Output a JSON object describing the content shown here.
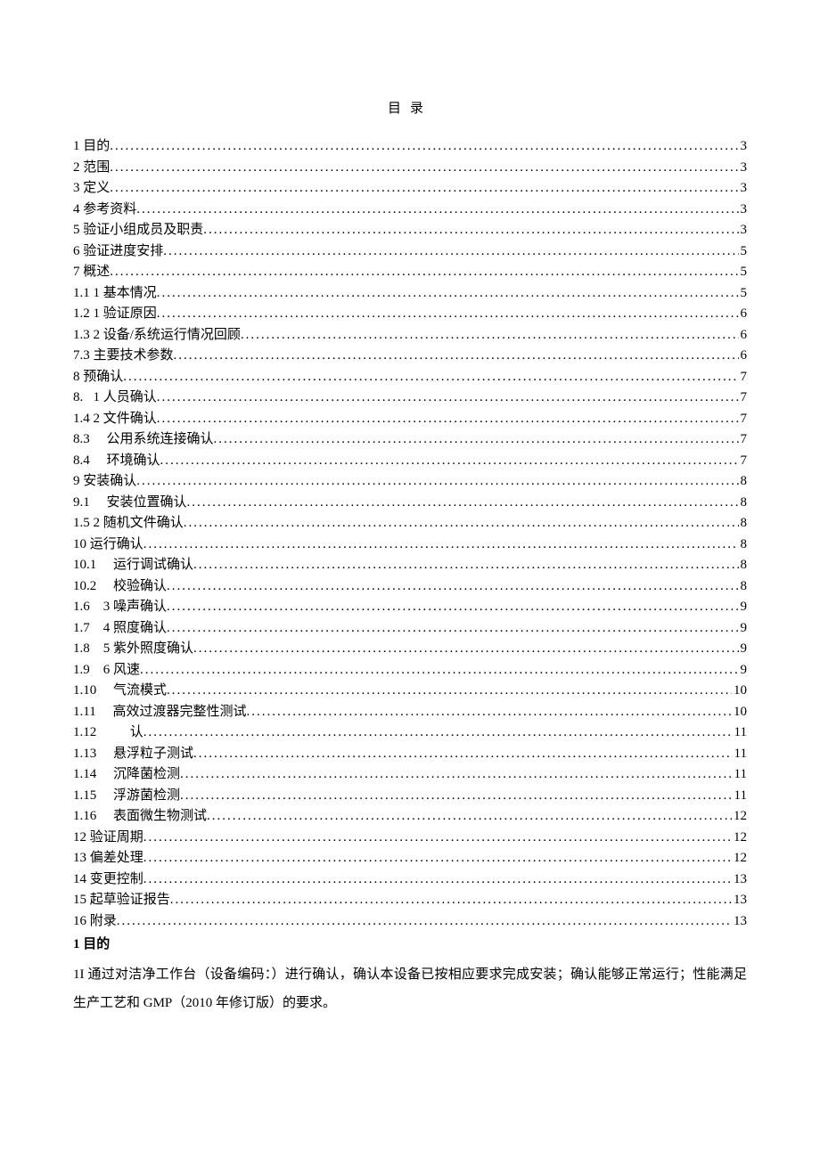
{
  "title": "目录",
  "toc": [
    {
      "label": "1 目的",
      "page": "3"
    },
    {
      "label": "2 范围",
      "page": "3"
    },
    {
      "label": "3 定义",
      "page": "3"
    },
    {
      "label": "4 参考资料",
      "page": "3"
    },
    {
      "label": "5 验证小组成员及职责",
      "page": "3"
    },
    {
      "label": "6 验证进度安排",
      "page": "5"
    },
    {
      "label": "7 概述",
      "page": "5"
    },
    {
      "label": "1.1  1 基本情况",
      "page": "5"
    },
    {
      "label": "1.2  1 验证原因",
      "page": "6"
    },
    {
      "label": "1.3  2 设备/系统运行情况回顾",
      "page": "6"
    },
    {
      "label": "7.3 主要技术参数",
      "page": "6"
    },
    {
      "label": "8 预确认",
      "page": "7"
    },
    {
      "label": "8.   1 人员确认",
      "page": "7"
    },
    {
      "label": "1.4  2 文件确认",
      "page": "7"
    },
    {
      "label": "8.3     公用系统连接确认",
      "page": "7"
    },
    {
      "label": "8.4     环境确认",
      "page": "7"
    },
    {
      "label": "9 安装确认",
      "page": "8"
    },
    {
      "label": "9.1     安装位置确认",
      "page": "8"
    },
    {
      "label": "1.5  2 随机文件确认",
      "page": "8"
    },
    {
      "label": "10 运行确认",
      "page": "8"
    },
    {
      "label": "10.1     运行调试确认",
      "page": "8"
    },
    {
      "label": "10.2     校验确认",
      "page": "8"
    },
    {
      "label": "1.6    3 噪声确认",
      "page": "9"
    },
    {
      "label": "1.7    4 照度确认",
      "page": "9"
    },
    {
      "label": "1.8    5 紫外照度确认",
      "page": "9"
    },
    {
      "label": "1.9    6 风速",
      "page": "9"
    },
    {
      "label": "1.10     气流模式",
      "page": "10"
    },
    {
      "label": "1.11     高效过渡器完整性测试",
      "page": "10"
    },
    {
      "label": "1.12          认",
      "page": "11"
    },
    {
      "label": "1.13     悬浮粒子测试",
      "page": "11"
    },
    {
      "label": "1.14     沉降菌检测",
      "page": "11"
    },
    {
      "label": "1.15     浮游菌检测",
      "page": "11"
    },
    {
      "label": "1.16     表面微生物测试",
      "page": "12"
    },
    {
      "label": "12 验证周期",
      "page": "12"
    },
    {
      "label": "13 偏差处理",
      "page": "12"
    },
    {
      "label": "14 变更控制",
      "page": "13"
    },
    {
      "label": "15 起草验证报告",
      "page": "13"
    },
    {
      "label": "16 附录",
      "page": "13"
    }
  ],
  "section1": {
    "heading": "1 目的",
    "body": "1I 通过对洁净工作台（设备编码：）进行确认，确认本设备已按相应要求完成安装；确认能够正常运行；性能满足生产工艺和 GMP（2010 年修订版）的要求。"
  }
}
